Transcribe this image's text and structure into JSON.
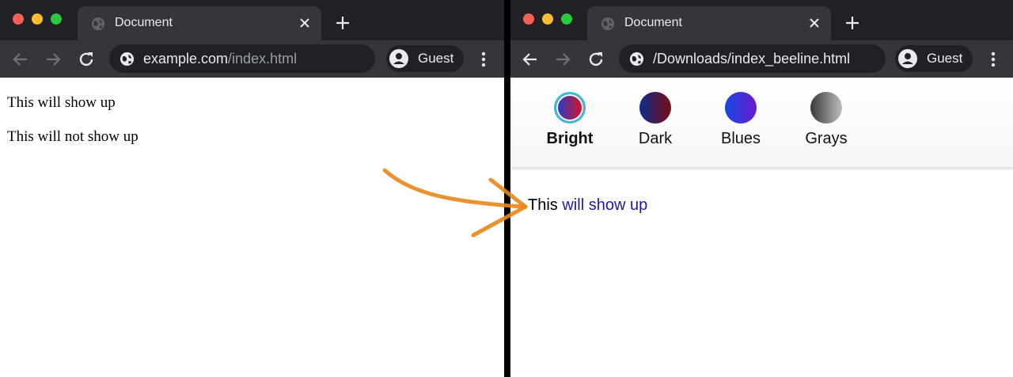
{
  "left_window": {
    "tab_title": "Document",
    "url_domain": "example.com",
    "url_path": "/index.html",
    "profile_label": "Guest",
    "lines": [
      "This will show up",
      "This will not show up"
    ]
  },
  "right_window": {
    "tab_title": "Document",
    "url": "/Downloads/index_beeline.html",
    "profile_label": "Guest",
    "themes": [
      {
        "label": "Bright",
        "selected": true,
        "colors": [
          "#1e3fd1",
          "#e0101c"
        ]
      },
      {
        "label": "Dark",
        "selected": false,
        "colors": [
          "#0c2c8c",
          "#7a0d14"
        ]
      },
      {
        "label": "Blues",
        "selected": false,
        "colors": [
          "#1548e0",
          "#6a1ad0"
        ]
      },
      {
        "label": "Grays",
        "selected": false,
        "colors": [
          "#3a3a3a",
          "#bdbdbd"
        ]
      }
    ],
    "reading_words": [
      "This",
      "will",
      "show",
      "up"
    ]
  },
  "colors": {
    "tabstrip": "#202124",
    "tab": "#35363a",
    "selected_ring": "#3fb8d6",
    "arrow": "#e8861a",
    "reading_blue": "#1d1aa3"
  },
  "icons": [
    "globe-icon",
    "close-icon",
    "plus-icon",
    "back-arrow-icon",
    "forward-arrow-icon",
    "reload-icon",
    "avatar-icon",
    "kebab-menu-icon"
  ]
}
